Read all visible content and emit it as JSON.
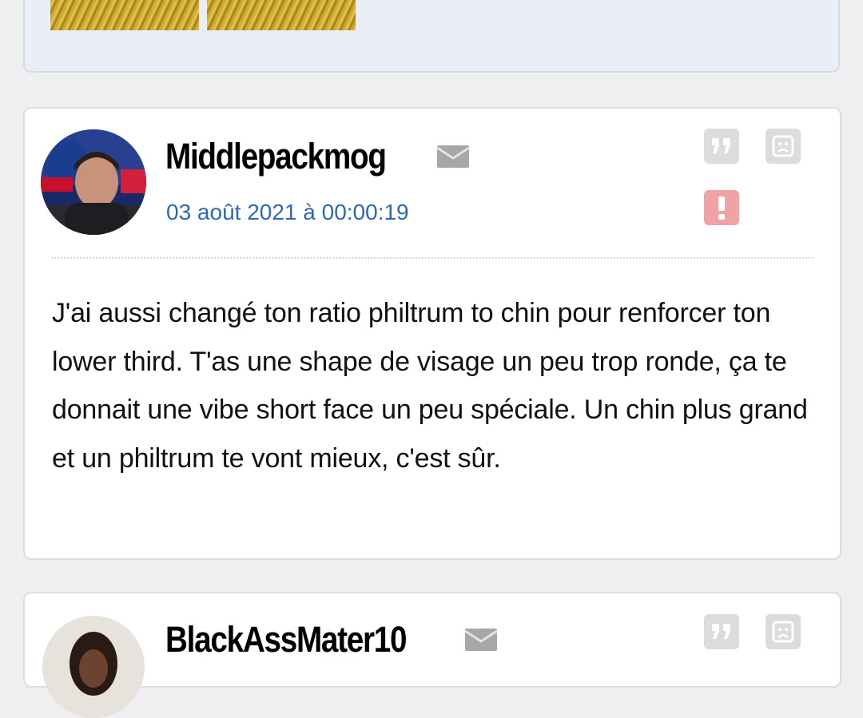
{
  "previous_post": {
    "images": [
      "thumbnail-1",
      "thumbnail-2"
    ]
  },
  "posts": [
    {
      "username": "Middlepackmog",
      "date": "03 août 2021 à 00:00:19",
      "message": "J'ai aussi changé ton ratio philtrum to chin pour renforcer ton lower third. T'as une shape de visage un peu trop ronde, ça te donnait une vibe short face un peu spéciale. Un chin plus grand et un philtrum te vont mieux, c'est sûr.",
      "icons": [
        "avatar",
        "mail-icon",
        "quote-icon",
        "sad-face-icon",
        "alert-icon"
      ]
    },
    {
      "username": "BlackAssMater10",
      "icons": [
        "avatar",
        "mail-icon",
        "quote-icon",
        "sad-face-icon"
      ]
    }
  ],
  "colors": {
    "date_link": "#2d6ab0",
    "alert": "#f1a2a4",
    "action_gray": "#dcdcdc"
  }
}
